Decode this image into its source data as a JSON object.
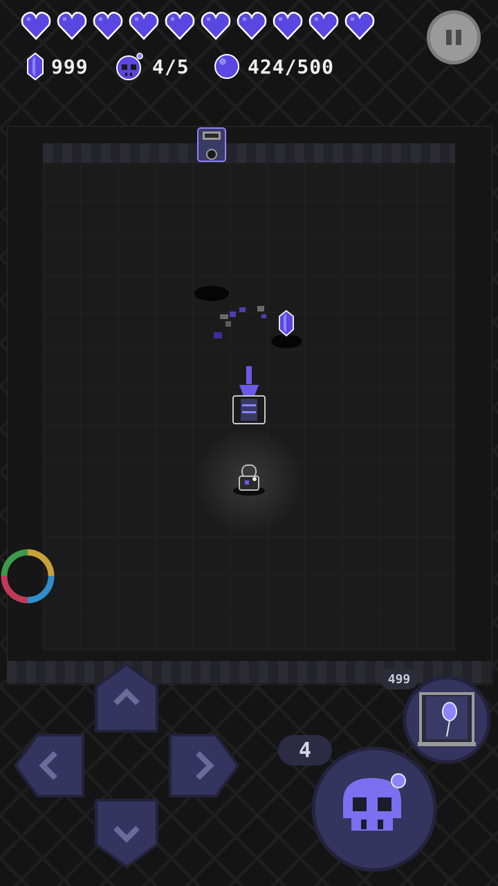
{
  "hud": {
    "hearts": {
      "filled": 10,
      "total": 10
    },
    "gems": {
      "icon": "gem-icon",
      "value": "999"
    },
    "skull_bombs": {
      "icon": "skull-bomb-icon",
      "value": "4/5"
    },
    "orbs": {
      "icon": "orb-icon",
      "value": "424/500"
    },
    "pause_icon": "pause-icon"
  },
  "controls": {
    "dpad": [
      "up",
      "left",
      "right",
      "down"
    ],
    "item_badge": "499",
    "bomb_count": "4",
    "item_icon": "balloon-scroll-icon",
    "attack_icon": "skull-icon"
  },
  "colors": {
    "accent": "#6b5ae8",
    "accent_light": "#8e84ff",
    "heart": "#5a46e0",
    "button_fill": "#34345e",
    "button_border": "#23233d"
  }
}
